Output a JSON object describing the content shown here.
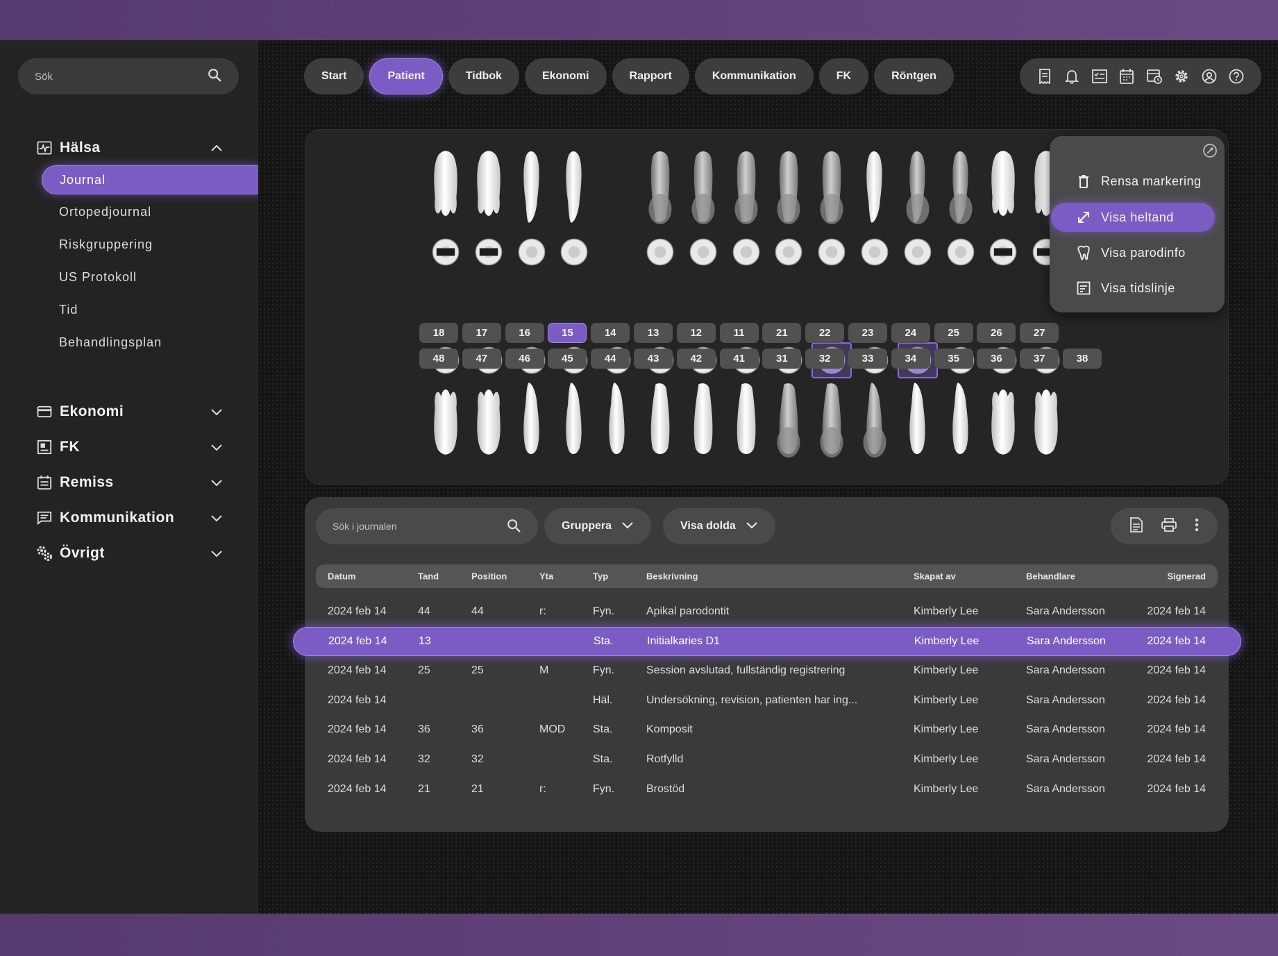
{
  "sidebar": {
    "search_placeholder": "Sök",
    "sections": [
      {
        "label": "Hälsa",
        "icon": "health-chart-icon",
        "expanded": true
      },
      {
        "label": "Ekonomi",
        "icon": "card-icon",
        "expanded": false
      },
      {
        "label": "FK",
        "icon": "document-icon",
        "expanded": false
      },
      {
        "label": "Remiss",
        "icon": "calendar-icon",
        "expanded": false
      },
      {
        "label": "Kommunikation",
        "icon": "message-icon",
        "expanded": false
      },
      {
        "label": "Övrigt",
        "icon": "gears-icon",
        "expanded": false
      }
    ],
    "health_items": [
      {
        "label": "Journal",
        "active": true
      },
      {
        "label": "Ortopedjournal"
      },
      {
        "label": "Riskgruppering"
      },
      {
        "label": "US Protokoll"
      },
      {
        "label": "Tid"
      },
      {
        "label": "Behandlingsplan"
      }
    ]
  },
  "nav": {
    "tabs": [
      {
        "label": "Start"
      },
      {
        "label": "Patient",
        "active": true
      },
      {
        "label": "Tidbok"
      },
      {
        "label": "Ekonomi"
      },
      {
        "label": "Rapport"
      },
      {
        "label": "Kommunikation"
      },
      {
        "label": "FK"
      },
      {
        "label": "Röntgen"
      }
    ],
    "tool_icons": [
      "receipt-icon",
      "bell-icon",
      "checklist-icon",
      "calendar-icon",
      "schedule-icon",
      "settings-icon",
      "user-icon",
      "help-icon"
    ]
  },
  "tooth_chart": {
    "upper_numbers": [
      "18",
      "17",
      "16",
      "15",
      "14",
      "13",
      "12",
      "11",
      "21",
      "22",
      "23",
      "24",
      "25",
      "26",
      "27"
    ],
    "lower_numbers": [
      "48",
      "47",
      "46",
      "45",
      "44",
      "43",
      "42",
      "41",
      "31",
      "32",
      "33",
      "34",
      "35",
      "36",
      "37",
      "38"
    ],
    "selected_number": "15",
    "highlighted_lower_teeth": [
      "32",
      "34"
    ]
  },
  "context_menu": {
    "items": [
      {
        "label": "Rensa markering",
        "icon": "trash-icon"
      },
      {
        "label": "Visa heltand",
        "icon": "expand-icon",
        "active": true
      },
      {
        "label": "Visa parodinfo",
        "icon": "tooth-icon"
      },
      {
        "label": "Visa tidslinje",
        "icon": "timeline-icon"
      }
    ]
  },
  "journal": {
    "search_placeholder": "Sök i journalen",
    "group_label": "Gruppera",
    "hidden_label": "Visa dolda",
    "columns": [
      "Datum",
      "Tand",
      "Position",
      "Yta",
      "Typ",
      "Beskrivning",
      "Skapat av",
      "Behandlare",
      "Signerad"
    ],
    "rows": [
      [
        "2024 feb 14",
        "44",
        "44",
        "r:",
        "Fyn.",
        "Apikal parodontit",
        "Kimberly Lee",
        "Sara Andersson",
        "2024 feb 14"
      ],
      [
        "2024 feb 14",
        "13",
        "",
        "",
        "Sta.",
        "Initialkaries D1",
        "Kimberly Lee",
        "Sara Andersson",
        "2024 feb 14"
      ],
      [
        "2024 feb 14",
        "25",
        "25",
        "M",
        "Fyn.",
        "Session avslutad, fullständig registrering",
        "Kimberly Lee",
        "Sara Andersson",
        "2024 feb 14"
      ],
      [
        "2024 feb 14",
        "",
        "",
        "",
        "Häl.",
        "Undersökning, revision, patienten har ing...",
        "Kimberly Lee",
        "Sara Andersson",
        "2024 feb 14"
      ],
      [
        "2024 feb 14",
        "36",
        "36",
        "MOD",
        "Sta.",
        "Komposit",
        "Kimberly Lee",
        "Sara Andersson",
        "2024 feb 14"
      ],
      [
        "2024 feb 14",
        "32",
        "32",
        "",
        "Sta.",
        "Rotfylld",
        "Kimberly Lee",
        "Sara Andersson",
        "2024 feb 14"
      ],
      [
        "2024 feb 14",
        "21",
        "21",
        "r:",
        "Fyn.",
        "Brostöd",
        "Kimberly Lee",
        "Sara Andersson",
        "2024 feb 14"
      ]
    ],
    "highlighted_row": 1
  }
}
